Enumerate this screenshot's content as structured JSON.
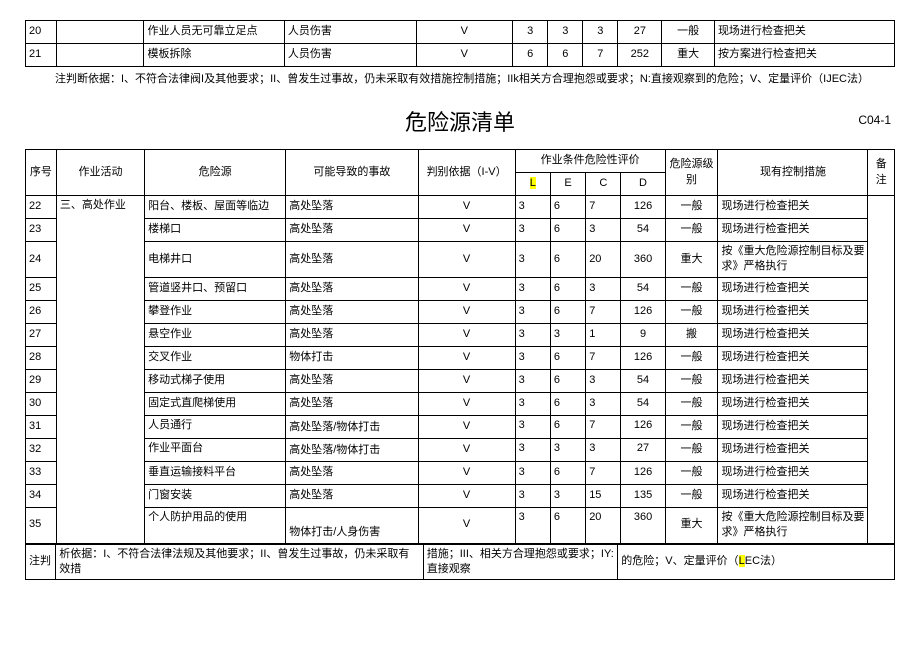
{
  "top_rows": [
    {
      "seq": "20",
      "act": "",
      "haz": "作业人员无可靠立足点",
      "acc": "人员伤害",
      "basis": "V",
      "l": "3",
      "e": "3",
      "c": "3",
      "d": "27",
      "level": "一般",
      "ctrl": "现场进行检查把关"
    },
    {
      "seq": "21",
      "act": "",
      "haz": "模板拆除",
      "acc": "人员伤害",
      "basis": "V",
      "l": "6",
      "e": "6",
      "c": "7",
      "d": "252",
      "level": "重大",
      "ctrl": "按方案进行检查把关"
    }
  ],
  "top_note": "注判断依据：I、不符合法律阀I及其他要求；II、曾发生过事故，仍未采取有效措施控制措施；IIk相关方合理抱怨或要求；N:直接观察到的危险；V、定量评价（IJEC法）",
  "title": "危险源清单",
  "doc_code": "C04-1",
  "headers": {
    "seq": "序号",
    "act": "作业活动",
    "haz": "危险源",
    "acc": "可能导致的事故",
    "basis": "判别依据（I-V）",
    "eval": "作业条件危险性评价",
    "l": "L",
    "e": "E",
    "c": "C",
    "d": "D",
    "level": "危险源级别",
    "ctrl": "现有控制措施",
    "note": "备注"
  },
  "rows": [
    {
      "seq": "22",
      "act": "三、高处作业",
      "haz": "阳台、楼板、屋面等临边",
      "acc": "高处坠落",
      "basis": "V",
      "l": "3",
      "e": "6",
      "c": "7",
      "d": "126",
      "level": "一般",
      "ctrl": "现场进行检查把关"
    },
    {
      "seq": "23",
      "act": "",
      "haz": "楼梯口",
      "acc": "高处坠落",
      "basis": "V",
      "l": "3",
      "e": "6",
      "c": "3",
      "d": "54",
      "level": "一般",
      "ctrl": "现场进行检查把关"
    },
    {
      "seq": "24",
      "act": "",
      "haz": "电梯井口",
      "acc": "高处坠落",
      "basis": "V",
      "l": "3",
      "e": "6",
      "c": "20",
      "d": "360",
      "level": "重大",
      "ctrl": "按《重大危险源控制目标及要求》严格执行"
    },
    {
      "seq": "25",
      "act": "",
      "haz": "管道竖井口、预留口",
      "acc": "高处坠落",
      "basis": "V",
      "l": "3",
      "e": "6",
      "c": "3",
      "d": "54",
      "level": "一般",
      "ctrl": "现场进行检查把关"
    },
    {
      "seq": "26",
      "act": "",
      "haz": "攀登作业",
      "acc": "高处坠落",
      "basis": "V",
      "l": "3",
      "e": "6",
      "c": "7",
      "d": "126",
      "level": "一般",
      "ctrl": "现场进行检查把关"
    },
    {
      "seq": "27",
      "act": "",
      "haz": "悬空作业",
      "acc": "高处坠落",
      "basis": "V",
      "l": "3",
      "e": "3",
      "c": "1",
      "d": "9",
      "level": "搬",
      "ctrl": "现场进行检查把关"
    },
    {
      "seq": "28",
      "act": "",
      "haz": "交叉作业",
      "acc": "物体打击",
      "basis": "V",
      "l": "3",
      "e": "6",
      "c": "7",
      "d": "126",
      "level": "一般",
      "ctrl": "现场进行检查把关"
    },
    {
      "seq": "29",
      "act": "",
      "haz": "移动式梯子使用",
      "acc": "高处坠落",
      "basis": "V",
      "l": "3",
      "e": "6",
      "c": "3",
      "d": "54",
      "level": "一般",
      "ctrl": "现场进行检查把关"
    },
    {
      "seq": "30",
      "act": "",
      "haz": "固定式直爬梯使用",
      "acc": "高处坠落",
      "basis": "V",
      "l": "3",
      "e": "6",
      "c": "3",
      "d": "54",
      "level": "一般",
      "ctrl": "现场进行检查把关"
    },
    {
      "seq": "31",
      "act": "",
      "haz": "人员通行",
      "acc": "高处坠落/物体打击",
      "basis": "V",
      "l": "3",
      "e": "6",
      "c": "7",
      "d": "126",
      "level": "一般",
      "ctrl": "现场进行检查把关",
      "tall": true
    },
    {
      "seq": "32",
      "act": "",
      "haz": "作业平面台",
      "acc": "高处坠落/物体打击",
      "basis": "V",
      "l": "3",
      "e": "3",
      "c": "3",
      "d": "27",
      "level": "一般",
      "ctrl": "现场进行检查把关",
      "tall": true
    },
    {
      "seq": "33",
      "act": "",
      "haz": "垂直运输接料平台",
      "acc": "高处坠落",
      "basis": "V",
      "l": "3",
      "e": "6",
      "c": "7",
      "d": "126",
      "level": "一般",
      "ctrl": "现场进行检查把关"
    },
    {
      "seq": "34",
      "act": "",
      "haz": "门窗安装",
      "acc": "高处坠落",
      "basis": "V",
      "l": "3",
      "e": "3",
      "c": "15",
      "d": "135",
      "level": "一般",
      "ctrl": "现场进行检查把关"
    },
    {
      "seq": "35",
      "act": "",
      "haz": "个人防护用品的使用",
      "acc": "物体打击/人身伤害",
      "basis": "V",
      "l": "3",
      "e": "6",
      "c": "20",
      "d": "360",
      "level": "重大",
      "ctrl": "按《重大危险源控制目标及要求》严格执行",
      "tall": true
    }
  ],
  "bottom_note": {
    "p1": "注判",
    "p2": "析依据：I、不符合法律法规及其他要求；II、曾发生过事故，仍未采取有效措",
    "p3": "措施；III、相关方合理抱怨",
    "p4": "或要求；IY:直接观察",
    "p5": "的危险；V、定量评价（",
    "p6": "L",
    "p7": "EC法）"
  }
}
